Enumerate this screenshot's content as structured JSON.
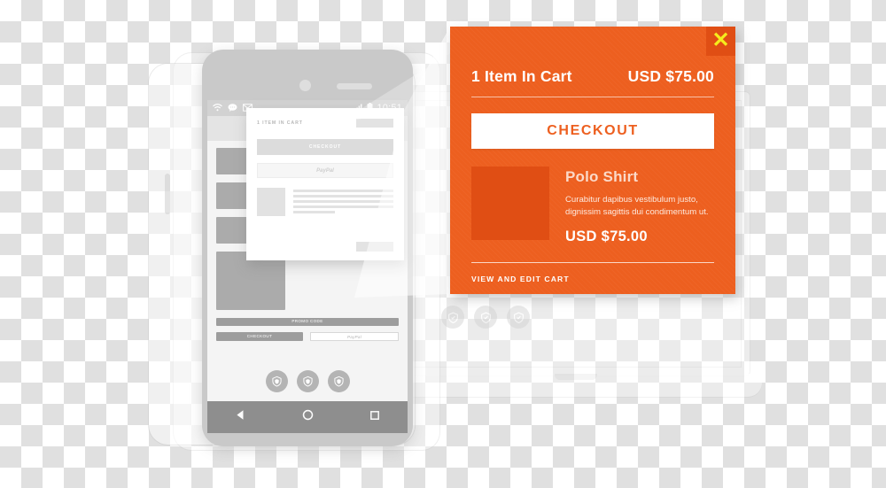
{
  "panel": {
    "close_icon": "close-x-icon",
    "cart_label": "1 Item In Cart",
    "cart_total": "USD $75.00",
    "checkout_label": "CHECKOUT",
    "product": {
      "name": "Polo Shirt",
      "description": "Curabitur dapibus vestibulum justo, dignissim sagittis dui condimentum ut.",
      "price": "USD $75.00",
      "thumbnail": "product-image-placeholder"
    },
    "view_cart_label": "VIEW AND EDIT CART",
    "colors": {
      "panel_bg": "#ed5f1f",
      "panel_accent": "#e04e14",
      "close_x": "#f5ec1d",
      "checkout_bg": "#ffffff",
      "checkout_text": "#ed5f1f"
    }
  },
  "phone": {
    "statusbar": {
      "wifi_icon": "wifi-icon",
      "chat_icon": "chat-bubble-icon",
      "mail_icon": "mail-icon",
      "signal_icon": "signal-bars-icon",
      "battery_icon": "battery-icon",
      "time": "10:51"
    },
    "navbar": {
      "back_icon": "back-triangle-icon",
      "home_icon": "home-circle-icon",
      "recents_icon": "recents-square-icon"
    },
    "page": {
      "promo_label": "PROMO CODE",
      "checkout_label": "CHECKOUT",
      "paypal_label": "PayPal",
      "trust_badges": [
        "shield-badge-icon",
        "shield-badge-icon",
        "shield-badge-icon"
      ]
    }
  },
  "cart_card": {
    "title": "1 ITEM IN CART",
    "checkout_label": "CHECKOUT",
    "paypal_label": "PayPal"
  },
  "background": {
    "checker_light": "#ffffff",
    "checker_dark": "#e0e0e0",
    "checker_size_px": 24,
    "ghost_badges": [
      "shield-badge-icon",
      "shield-badge-icon",
      "shield-badge-icon"
    ]
  }
}
